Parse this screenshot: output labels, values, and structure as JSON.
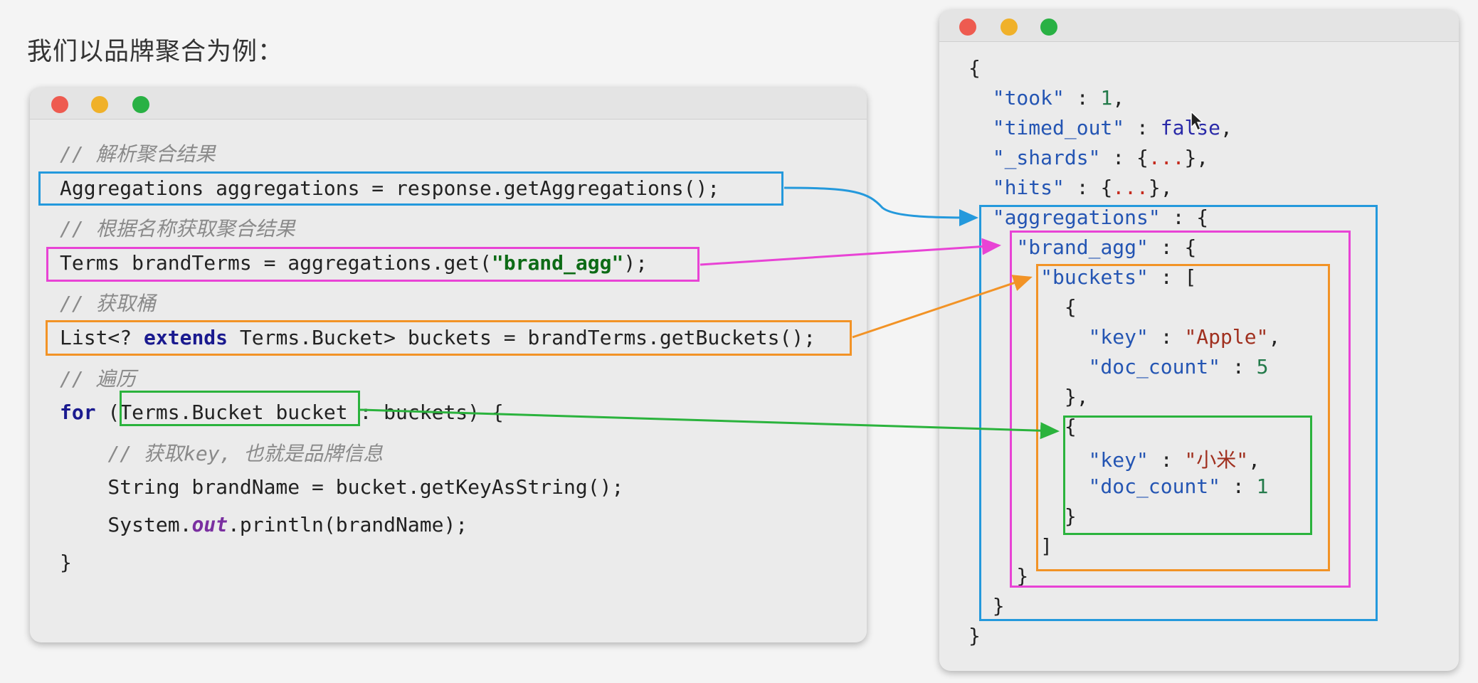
{
  "page": {
    "title": "我们以品牌聚合为例："
  },
  "colors": {
    "blue": "#2499dc",
    "pink": "#e843d5",
    "orange": "#f29326",
    "green": "#2bb33d",
    "window_close": "#ee5b50",
    "window_minimize": "#f0b12a",
    "window_zoom": "#29b144"
  },
  "java": {
    "lines": [
      [
        {
          "t": "// 解析聚合结果",
          "c": "comment"
        }
      ],
      [
        {
          "t": "Aggregations aggregations = response.getAggregations();",
          "c": ""
        }
      ],
      [
        {
          "t": "// 根据名称获取聚合结果",
          "c": "comment"
        }
      ],
      [
        {
          "t": "Terms brandTerms = aggregations.get(",
          "c": ""
        },
        {
          "t": "\"brand_agg\"",
          "c": "str"
        },
        {
          "t": ");",
          "c": ""
        }
      ],
      [
        {
          "t": "// 获取桶",
          "c": "comment"
        }
      ],
      [
        {
          "t": "List<? ",
          "c": ""
        },
        {
          "t": "extends",
          "c": "kw"
        },
        {
          "t": " Terms.Bucket> buckets = brandTerms.getBuckets();",
          "c": ""
        }
      ],
      [
        {
          "t": "// 遍历",
          "c": "comment"
        }
      ],
      [
        {
          "t": "for",
          "c": "kw"
        },
        {
          "t": " (Terms.Bucket bucket : buckets) {",
          "c": ""
        }
      ],
      [
        {
          "t": "    ",
          "c": ""
        },
        {
          "t": "// 获取key, 也就是品牌信息",
          "c": "comment"
        }
      ],
      [
        {
          "t": "    String brandName = bucket.getKeyAsString();",
          "c": ""
        }
      ],
      [
        {
          "t": "    System.",
          "c": ""
        },
        {
          "t": "out",
          "c": "field"
        },
        {
          "t": ".println(brandName);",
          "c": ""
        }
      ],
      [
        {
          "t": "}",
          "c": ""
        }
      ]
    ]
  },
  "json": {
    "lines": [
      [
        {
          "t": "{",
          "c": ""
        }
      ],
      [
        {
          "t": "  ",
          "c": ""
        },
        {
          "t": "\"took\"",
          "c": "j-key"
        },
        {
          "t": " : ",
          "c": ""
        },
        {
          "t": "1",
          "c": "j-num"
        },
        {
          "t": ",",
          "c": ""
        }
      ],
      [
        {
          "t": "  ",
          "c": ""
        },
        {
          "t": "\"timed_out\"",
          "c": "j-key"
        },
        {
          "t": " : ",
          "c": ""
        },
        {
          "t": "false",
          "c": "j-bool"
        },
        {
          "t": ",",
          "c": ""
        }
      ],
      [
        {
          "t": "  ",
          "c": ""
        },
        {
          "t": "\"_shards\"",
          "c": "j-key"
        },
        {
          "t": " : {",
          "c": ""
        },
        {
          "t": "...",
          "c": "j-ell"
        },
        {
          "t": "},",
          "c": ""
        }
      ],
      [
        {
          "t": "  ",
          "c": ""
        },
        {
          "t": "\"hits\"",
          "c": "j-key"
        },
        {
          "t": " : {",
          "c": ""
        },
        {
          "t": "...",
          "c": "j-ell"
        },
        {
          "t": "},",
          "c": ""
        }
      ],
      [
        {
          "t": "  ",
          "c": ""
        },
        {
          "t": "\"aggregations\"",
          "c": "j-key"
        },
        {
          "t": " : {",
          "c": ""
        }
      ],
      [
        {
          "t": "    ",
          "c": ""
        },
        {
          "t": "\"brand_agg\"",
          "c": "j-key"
        },
        {
          "t": " : {",
          "c": ""
        }
      ],
      [
        {
          "t": "      ",
          "c": ""
        },
        {
          "t": "\"buckets\"",
          "c": "j-key"
        },
        {
          "t": " : [",
          "c": ""
        }
      ],
      [
        {
          "t": "        {",
          "c": ""
        }
      ],
      [
        {
          "t": "          ",
          "c": ""
        },
        {
          "t": "\"key\"",
          "c": "j-key"
        },
        {
          "t": " : ",
          "c": ""
        },
        {
          "t": "\"Apple\"",
          "c": "j-str"
        },
        {
          "t": ",",
          "c": ""
        }
      ],
      [
        {
          "t": "          ",
          "c": ""
        },
        {
          "t": "\"doc_count\"",
          "c": "j-key"
        },
        {
          "t": " : ",
          "c": ""
        },
        {
          "t": "5",
          "c": "j-num"
        }
      ],
      [
        {
          "t": "        },",
          "c": ""
        }
      ],
      [
        {
          "t": "        {",
          "c": ""
        }
      ],
      [
        {
          "t": "          ",
          "c": ""
        },
        {
          "t": "\"key\"",
          "c": "j-key"
        },
        {
          "t": " : ",
          "c": ""
        },
        {
          "t": "\"小米\"",
          "c": "j-str"
        },
        {
          "t": ",",
          "c": ""
        }
      ],
      [
        {
          "t": "          ",
          "c": ""
        },
        {
          "t": "\"doc_count\"",
          "c": "j-key"
        },
        {
          "t": " : ",
          "c": ""
        },
        {
          "t": "1",
          "c": "j-num"
        }
      ],
      [
        {
          "t": "        }",
          "c": ""
        }
      ],
      [
        {
          "t": "      ]",
          "c": ""
        }
      ],
      [
        {
          "t": "    }",
          "c": ""
        }
      ],
      [
        {
          "t": "  }",
          "c": ""
        }
      ],
      [
        {
          "t": "}",
          "c": ""
        }
      ]
    ]
  }
}
